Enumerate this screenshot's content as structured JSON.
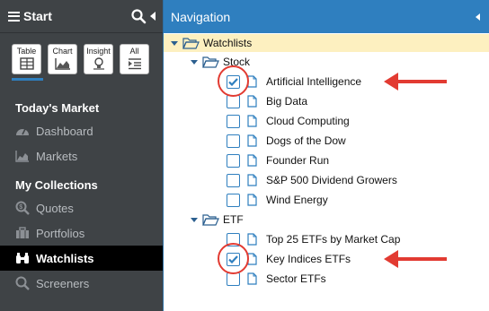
{
  "sidebar": {
    "title": "Start",
    "views": [
      {
        "label": "Table",
        "icon": "table-icon"
      },
      {
        "label": "Chart",
        "icon": "chart-icon"
      },
      {
        "label": "Insight",
        "icon": "insight-icon"
      },
      {
        "label": "All",
        "icon": "all-list-icon"
      }
    ],
    "sections": [
      {
        "title": "Today's Market",
        "items": [
          {
            "label": "Dashboard",
            "icon": "dashboard-gauge-icon"
          },
          {
            "label": "Markets",
            "icon": "area-chart-icon"
          }
        ]
      },
      {
        "title": "My Collections",
        "items": [
          {
            "label": "Quotes",
            "icon": "dollar-search-icon"
          },
          {
            "label": "Portfolios",
            "icon": "briefcase-icon"
          },
          {
            "label": "Watchlists",
            "icon": "binoculars-icon",
            "active": true
          },
          {
            "label": "Screeners",
            "icon": "search-icon"
          }
        ]
      }
    ]
  },
  "navigation": {
    "title": "Navigation",
    "root": "Watchlists",
    "groups": [
      {
        "name": "Stock",
        "items": [
          {
            "label": "Artificial Intelligence",
            "checked": true
          },
          {
            "label": "Big Data",
            "checked": false
          },
          {
            "label": "Cloud Computing",
            "checked": false
          },
          {
            "label": "Dogs of the Dow",
            "checked": false
          },
          {
            "label": "Founder Run",
            "checked": false
          },
          {
            "label": "S&P 500 Dividend Growers",
            "checked": false
          },
          {
            "label": "Wind Energy",
            "checked": false
          }
        ]
      },
      {
        "name": "ETF",
        "items": [
          {
            "label": "Top 25 ETFs by Market Cap",
            "checked": false
          },
          {
            "label": "Key Indices ETFs",
            "checked": true
          },
          {
            "label": "Sector ETFs",
            "checked": false
          }
        ]
      }
    ]
  },
  "colors": {
    "accent": "#2f7fbf",
    "sidebar_bg": "#3f4346",
    "highlight_row": "#fdf0c0",
    "annotation": "#e23b32"
  }
}
